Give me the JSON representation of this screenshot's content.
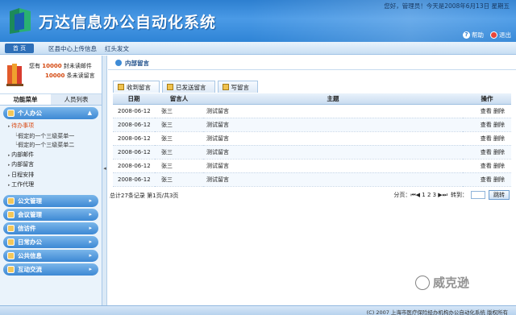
{
  "header": {
    "app_title": "万达信息办公自动化系统",
    "user_info": "您好，管理员！今天是2008年6月13日 星期五",
    "help_label": "帮助",
    "exit_label": "退出"
  },
  "nav": {
    "home_label": "首 页",
    "links": [
      "区县中心上传信息",
      "红头发文"
    ]
  },
  "sidebar": {
    "messages": {
      "line1_prefix": "您有",
      "line1_count": "10000",
      "line1_suffix": "封未读邮件",
      "line2_count": "10000",
      "line2_suffix": "条未读留言"
    },
    "tabs": [
      "功能菜单",
      "人员列表"
    ],
    "sections": [
      {
        "label": "个人办公",
        "expanded": true
      },
      {
        "label": "公文管理"
      },
      {
        "label": "会议管理"
      },
      {
        "label": "信访件"
      },
      {
        "label": "日常办公"
      },
      {
        "label": "公共信息"
      },
      {
        "label": "互动交流"
      }
    ],
    "sub_items": [
      {
        "label": "待办事项",
        "active": true
      },
      {
        "label": "假定的一个三级菜单一",
        "deep": true
      },
      {
        "label": "假定的一个三级菜单二",
        "deep": true
      },
      {
        "label": "内部邮件"
      },
      {
        "label": "内部留言"
      },
      {
        "label": "日程安排"
      },
      {
        "label": "工作代理"
      }
    ]
  },
  "main": {
    "breadcrumb": "内部留言",
    "tabs": [
      "收到留言",
      "已发送留言",
      "写留言"
    ],
    "columns": [
      "日期",
      "留言人",
      "主题",
      "操作"
    ],
    "rows": [
      {
        "date": "2008-06-12",
        "sender": "张三",
        "subject": "测试留言",
        "view": "查看",
        "delete": "删除"
      },
      {
        "date": "2008-06-12",
        "sender": "张三",
        "subject": "测试留言",
        "view": "查看",
        "delete": "删除"
      },
      {
        "date": "2008-06-12",
        "sender": "张三",
        "subject": "测试留言",
        "view": "查看",
        "delete": "删除"
      },
      {
        "date": "2008-06-12",
        "sender": "张三",
        "subject": "测试留言",
        "view": "查看",
        "delete": "删除"
      },
      {
        "date": "2008-06-12",
        "sender": "张三",
        "subject": "测试留言",
        "view": "查看",
        "delete": "删除"
      },
      {
        "date": "2008-06-12",
        "sender": "张三",
        "subject": "测试留言",
        "view": "查看",
        "delete": "删除"
      }
    ],
    "pager": {
      "summary": "总计27条记录    第1页/共3页",
      "pages_label": "分页：⏮◀ 1 2 3 ▶⏭",
      "goto_label": "转到：",
      "jump_button": "跳转"
    }
  },
  "footer": {
    "copyright": "(C) 2007  上海市医疗保险经办机构办公自动化系统 版权所有"
  },
  "watermark": {
    "text": "威克逊"
  },
  "colors": {
    "header_blue": "#2d7fd0",
    "accent_orange": "#d94812",
    "menu_blue": "#3d88d4"
  }
}
